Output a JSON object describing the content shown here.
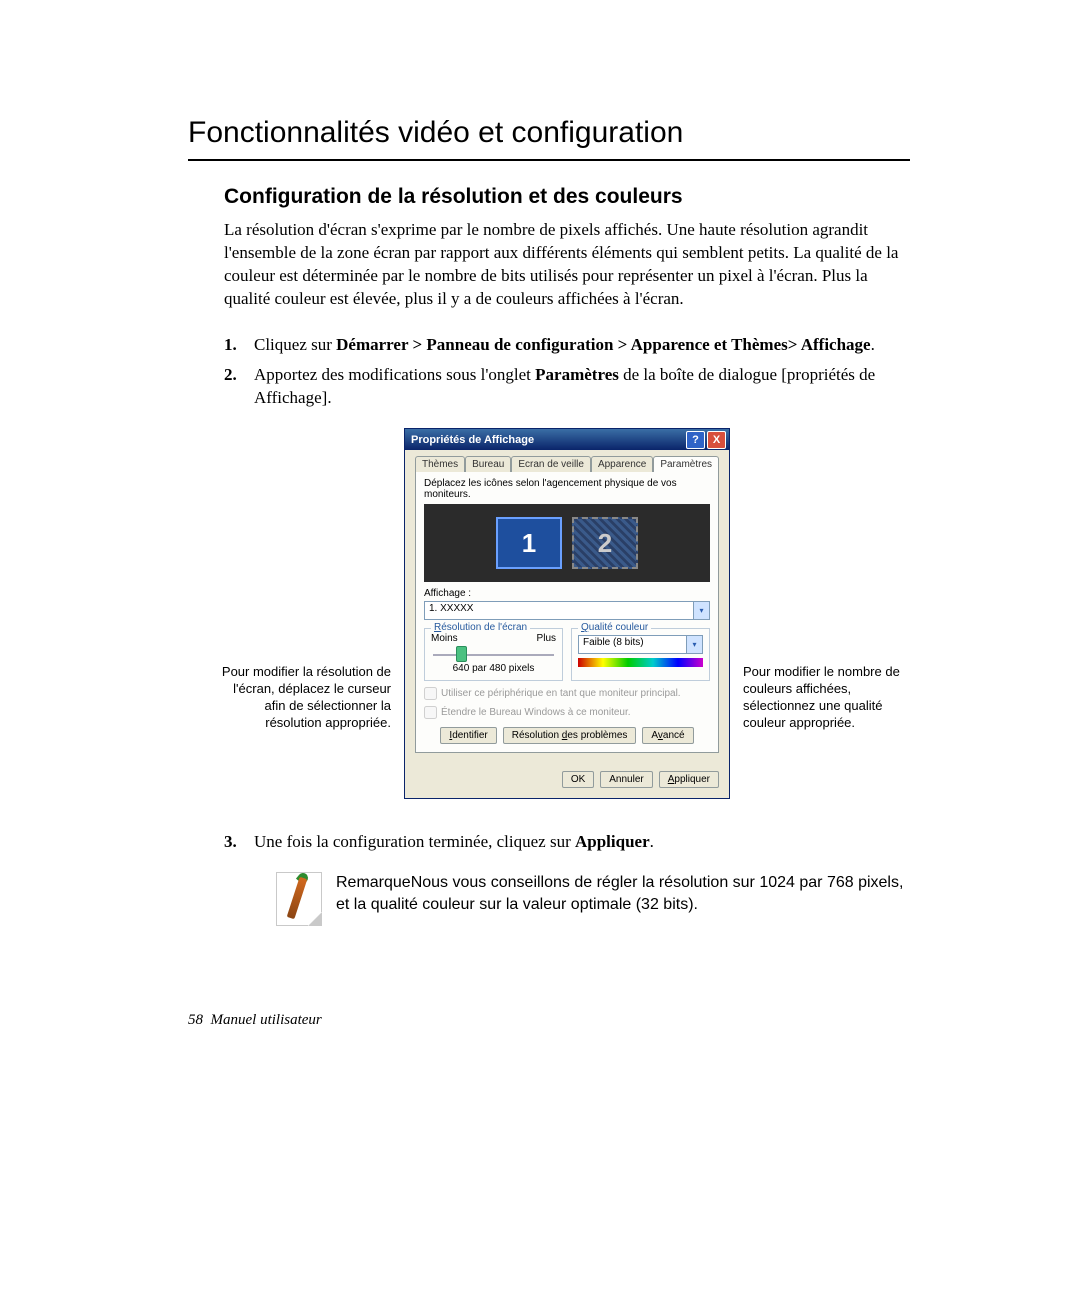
{
  "chapter": {
    "title": "Fonctionnalités vidéo et configuration"
  },
  "section": {
    "subtitle": "Configuration de la résolution et des couleurs",
    "intro": "La résolution d'écran s'exprime par le nombre de pixels affichés. Une haute résolution agrandit l'ensemble de la zone écran par rapport aux différents éléments qui semblent petits. La qualité de la couleur est déterminée par le nombre de bits utilisés pour représenter un pixel à l'écran. Plus la qualité couleur est élevée, plus il y a de couleurs affichées à l'écran."
  },
  "steps": {
    "s1": {
      "num": "1.",
      "pre": "Cliquez sur ",
      "path": "Démarrer > Panneau de configuration > Apparence et Thèmes> Affichage",
      "post": "."
    },
    "s2": {
      "num": "2.",
      "pre": "Apportez des modifications sous l'onglet ",
      "bold": "Paramètres",
      "post": " de la boîte de dialogue [propriétés de Affichage]."
    },
    "s3": {
      "num": "3.",
      "pre": "Une fois la configuration terminée, cliquez sur ",
      "bold": "Appliquer",
      "post": "."
    }
  },
  "annot": {
    "left": "Pour modifier la résolution de l'écran, déplacez le curseur afin de sélectionner la résolution appropriée.",
    "right": "Pour modifier le nombre de couleurs affichées, sélectionnez une qualité couleur appropriée."
  },
  "dialog": {
    "title": "Propriétés de Affichage",
    "help": "?",
    "close": "X",
    "tabs": {
      "t1": "Thèmes",
      "t2": "Bureau",
      "t3": "Ecran de veille",
      "t4": "Apparence",
      "t5": "Paramètres"
    },
    "instr": "Déplacez les icônes selon l'agencement physique de vos moniteurs.",
    "monitor1": "1",
    "monitor2": "2",
    "display_lbl": "Affichage :",
    "display_val": "1. XXXXX",
    "group_res": "Résolution de l'écran",
    "res_less": "Moins",
    "res_more": "Plus",
    "res_value": "640 par 480 pixels",
    "group_color": "Qualité couleur",
    "color_val": "Faible (8 bits)",
    "chk1": "Utiliser ce périphérique en tant que moniteur principal.",
    "chk2": "Étendre le Bureau Windows à ce moniteur.",
    "btn_id": "Identifier",
    "btn_trb": "Résolution des problèmes",
    "btn_adv": "Avancé",
    "btn_ok": "OK",
    "btn_cancel": "Annuler",
    "btn_apply": "Appliquer"
  },
  "note": {
    "text": "RemarqueNous vous conseillons de régler la résolution sur 1024 par 768 pixels, et la qualité couleur sur la valeur optimale (32 bits)."
  },
  "footer": {
    "page": "58",
    "label": "Manuel utilisateur"
  }
}
